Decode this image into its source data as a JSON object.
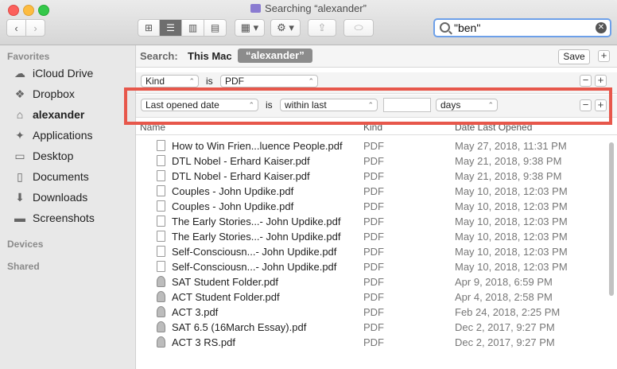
{
  "window": {
    "title": "Searching “alexander”"
  },
  "toolbar": {
    "back_glyph": "‹",
    "fwd_glyph": "›",
    "view_icons": [
      "icon-view-icon",
      "list-view-icon",
      "column-view-icon",
      "cover-flow-icon"
    ],
    "arrange_glyph": "▦ ▾",
    "action_glyph": "⚙ ▾",
    "share_glyph": "⇪",
    "tag_glyph": "⬭"
  },
  "search": {
    "value": "\"ben\"",
    "clear_glyph": "✕"
  },
  "sidebar": {
    "favorites_heading": "Favorites",
    "items": [
      {
        "label": "iCloud Drive",
        "icon": "cloud-icon",
        "glyph": "☁"
      },
      {
        "label": "Dropbox",
        "icon": "dropbox-icon",
        "glyph": "❖"
      },
      {
        "label": "alexander",
        "icon": "home-icon",
        "glyph": "⌂",
        "selected": true
      },
      {
        "label": "Applications",
        "icon": "applications-icon",
        "glyph": "✦"
      },
      {
        "label": "Desktop",
        "icon": "desktop-icon",
        "glyph": "▭"
      },
      {
        "label": "Documents",
        "icon": "documents-icon",
        "glyph": "▯"
      },
      {
        "label": "Downloads",
        "icon": "downloads-icon",
        "glyph": "⬇"
      },
      {
        "label": "Screenshots",
        "icon": "folder-icon",
        "glyph": "▬"
      }
    ],
    "devices_heading": "Devices",
    "shared_heading": "Shared"
  },
  "scope": {
    "label": "Search:",
    "this_mac": "This Mac",
    "selected": "“alexander”",
    "save": "Save"
  },
  "criteria": [
    {
      "attribute": "Kind",
      "operator": "is",
      "value": "PDF"
    },
    {
      "attribute": "Last opened date",
      "operator": "is",
      "value": "within last",
      "number": "",
      "unit": "days"
    }
  ],
  "columns": {
    "name": "Name",
    "kind": "Kind",
    "date": "Date Last Opened"
  },
  "files": [
    {
      "name": "How to Win Frien...luence People.pdf",
      "kind": "PDF",
      "date": "May 27, 2018, 11:31 PM",
      "folder": false
    },
    {
      "name": "DTL Nobel - Erhard Kaiser.pdf",
      "kind": "PDF",
      "date": "May 21, 2018, 9:38 PM",
      "folder": false
    },
    {
      "name": "DTL Nobel - Erhard Kaiser.pdf",
      "kind": "PDF",
      "date": "May 21, 2018, 9:38 PM",
      "folder": false
    },
    {
      "name": "Couples - John Updike.pdf",
      "kind": "PDF",
      "date": "May 10, 2018, 12:03 PM",
      "folder": false
    },
    {
      "name": "Couples - John Updike.pdf",
      "kind": "PDF",
      "date": "May 10, 2018, 12:03 PM",
      "folder": false
    },
    {
      "name": "The Early Stories...- John Updike.pdf",
      "kind": "PDF",
      "date": "May 10, 2018, 12:03 PM",
      "folder": false
    },
    {
      "name": "The Early Stories...- John Updike.pdf",
      "kind": "PDF",
      "date": "May 10, 2018, 12:03 PM",
      "folder": false
    },
    {
      "name": "Self-Consciousn...- John Updike.pdf",
      "kind": "PDF",
      "date": "May 10, 2018, 12:03 PM",
      "folder": false
    },
    {
      "name": "Self-Consciousn...- John Updike.pdf",
      "kind": "PDF",
      "date": "May 10, 2018, 12:03 PM",
      "folder": false
    },
    {
      "name": "SAT Student Folder.pdf",
      "kind": "PDF",
      "date": "Apr 9, 2018, 6:59 PM",
      "folder": true
    },
    {
      "name": "ACT Student Folder.pdf",
      "kind": "PDF",
      "date": "Apr 4, 2018, 2:58 PM",
      "folder": true
    },
    {
      "name": "ACT 3.pdf",
      "kind": "PDF",
      "date": "Feb 24, 2018, 2:25 PM",
      "folder": true
    },
    {
      "name": "SAT 6.5 (16March Essay).pdf",
      "kind": "PDF",
      "date": "Dec 2, 2017, 9:27 PM",
      "folder": true
    },
    {
      "name": "ACT 3 RS.pdf",
      "kind": "PDF",
      "date": "Dec 2, 2017, 9:27 PM",
      "folder": true
    }
  ],
  "colors": {
    "highlight": "#e7574b",
    "search_focus": "#6da0e9"
  }
}
